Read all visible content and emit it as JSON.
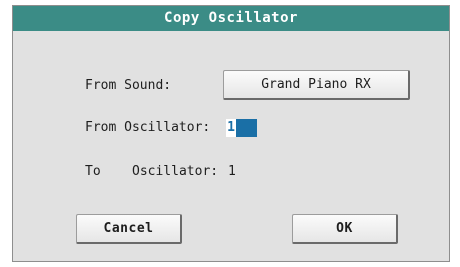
{
  "dialog": {
    "title": "Copy Oscillator"
  },
  "from_sound": {
    "label": "From Sound:",
    "value": "Grand Piano RX"
  },
  "from_oscillator": {
    "label": "From Oscillator:",
    "value": "1"
  },
  "to_oscillator": {
    "label_to": "To",
    "label_osc": "Oscillator:",
    "value": "1"
  },
  "buttons": {
    "cancel": "Cancel",
    "ok": "OK"
  },
  "colors": {
    "title_bar": "#3b8c86",
    "dialog_bg": "#e1e1e1",
    "field_highlight": "#1a6fa6"
  }
}
